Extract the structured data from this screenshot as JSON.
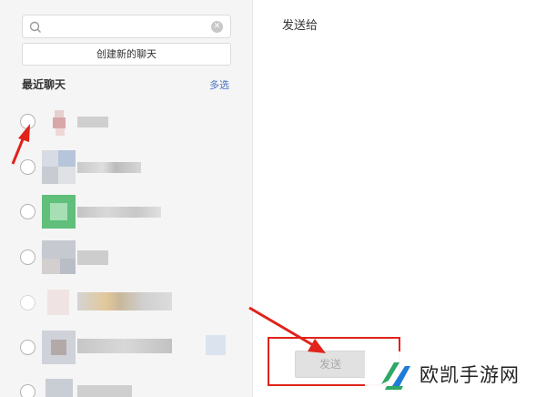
{
  "search": {
    "value": "",
    "placeholder": ""
  },
  "create_chat_label": "创建新的聊天",
  "recent_title": "最近聊天",
  "multi_select_label": "多选",
  "send_to_label": "发送给",
  "send_button_label": "发送",
  "watermark_text": "欧凯手游网",
  "colors": {
    "annotation_red": "#e0231b",
    "link_blue": "#4a73c2",
    "watermark_green": "#2ea866",
    "watermark_blue": "#1f7bd8"
  },
  "icons": [
    "search-icon",
    "clear-icon",
    "radio-icon",
    "arrow-annotation-icon",
    "watermark-logo-icon"
  ]
}
